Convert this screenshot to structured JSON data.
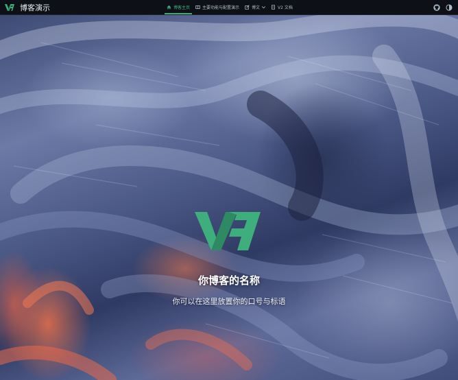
{
  "navbar": {
    "brand_title": "博客演示",
    "items": [
      {
        "label": "博客主页",
        "icon": "home-icon",
        "active": true
      },
      {
        "label": "主要功能与配置演示",
        "icon": "book-icon",
        "active": false
      },
      {
        "label": "博文",
        "icon": "edit-icon",
        "active": false,
        "has_dropdown": true
      },
      {
        "label": "V2 文档",
        "icon": "doc-icon",
        "active": false
      }
    ],
    "tools": [
      "github-icon",
      "theme-toggle-icon"
    ]
  },
  "hero": {
    "logo": "vh-logo",
    "title": "你博客的名称",
    "slogan": "你可以在这里放置你的口号与标语"
  },
  "colors": {
    "accent": "#3eaf7c",
    "navbar_bg": "#0d1117",
    "nav_text": "#adbac7"
  }
}
